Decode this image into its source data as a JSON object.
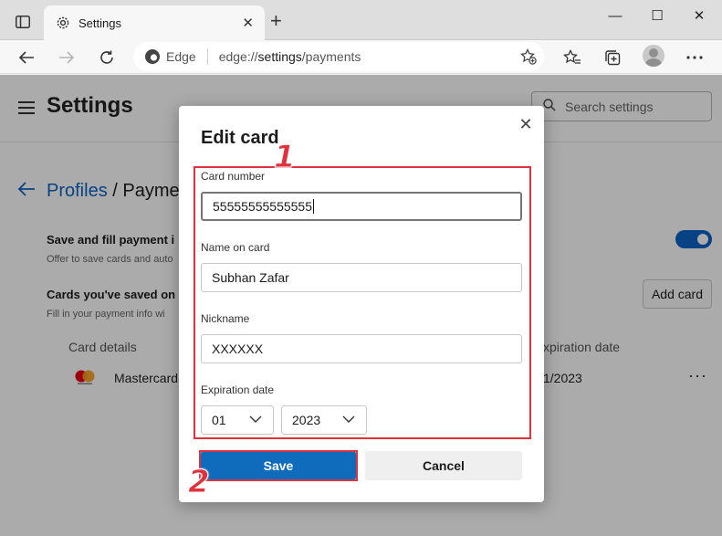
{
  "window": {
    "tab_title": "Settings",
    "new_tab_symbol": "+",
    "controls": {
      "minimize": "—",
      "maximize": "☐",
      "close": "✕"
    }
  },
  "toolbar": {
    "address": {
      "brand": "Edge",
      "url_prefix": "edge://",
      "url_host": "settings",
      "url_suffix": "/payments"
    }
  },
  "page": {
    "title": "Settings",
    "search_placeholder": "Search settings",
    "breadcrumb_link": "Profiles",
    "breadcrumb_current": "Payme",
    "breadcrumb_sep": " / ",
    "save_fill_title": "Save and fill payment i",
    "save_fill_sub": "Offer to save cards and auto",
    "saved_cards_title": "Cards you've saved on",
    "saved_cards_sub": "Fill in your payment info wi",
    "add_card_label": "Add card",
    "col_card_details": "Card details",
    "col_expiration": "xpiration date",
    "card_row": {
      "brand": "Mastercard",
      "expiration": "1/2023",
      "more": "···"
    }
  },
  "dialog": {
    "title": "Edit card",
    "close_symbol": "✕",
    "card_number": {
      "label": "Card number",
      "value": "55555555555555"
    },
    "name_on_card": {
      "label": "Name on card",
      "value": "Subhan Zafar"
    },
    "nickname": {
      "label": "Nickname",
      "value": "XXXXXX"
    },
    "expiration": {
      "label": "Expiration date",
      "month": "01",
      "year": "2023"
    },
    "save_label": "Save",
    "cancel_label": "Cancel"
  },
  "annotations": {
    "step1": "1",
    "step2": "2",
    "color": "#e0313d"
  },
  "colors": {
    "accent": "#0f6cbd",
    "link": "#0b63c5"
  }
}
